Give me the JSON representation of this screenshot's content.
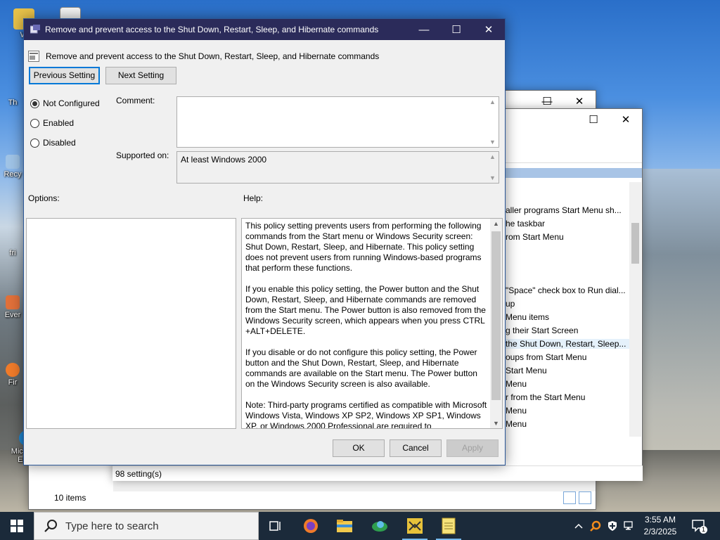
{
  "desktop": {
    "icons": [
      {
        "label": "W"
      },
      {
        "label": "Th"
      },
      {
        "label": "Recy"
      },
      {
        "label": "fri"
      },
      {
        "label": "Ever"
      },
      {
        "label": "Fir"
      },
      {
        "label": "Microsoft Edge"
      }
    ]
  },
  "background_window": {
    "status_items": "10 items",
    "status_settings": "98 setting(s)",
    "list_items": [
      "aller programs Start Menu sh...",
      "he taskbar",
      "rom Start Menu",
      "\"Space\" check box to Run dial...",
      "up",
      "Menu items",
      "g their Start Screen",
      "the Shut Down, Restart, Sleep...",
      "oups from Start Menu",
      "Start Menu",
      "Menu",
      "r from the Start Menu",
      "Menu",
      "Menu"
    ]
  },
  "dialog": {
    "window_title": "Remove and prevent access to the Shut Down, Restart, Sleep, and Hibernate commands",
    "policy_name": "Remove and prevent access to the Shut Down, Restart, Sleep, and Hibernate commands",
    "prev_label": "Previous Setting",
    "next_label": "Next Setting",
    "radio_not_configured": "Not Configured",
    "radio_enabled": "Enabled",
    "radio_disabled": "Disabled",
    "comment_label": "Comment:",
    "comment_value": "",
    "supported_label": "Supported on:",
    "supported_value": "At least Windows 2000",
    "options_label": "Options:",
    "help_label": "Help:",
    "help_paragraphs": [
      "This policy setting prevents users from performing the following commands from the Start menu or Windows Security screen: Shut Down, Restart, Sleep, and Hibernate. This policy setting does not prevent users from running Windows-based programs that perform these functions.",
      "If you enable this policy setting, the Power button and the Shut Down, Restart, Sleep, and Hibernate commands are removed from the Start menu. The Power button is also removed from the Windows Security screen, which appears when you press CTRL +ALT+DELETE.",
      "If you disable or do not configure this policy setting, the Power button and the Shut Down, Restart, Sleep, and Hibernate commands are available on the Start menu. The Power button on the Windows Security screen is also available.",
      "Note: Third-party programs certified as compatible with Microsoft Windows Vista, Windows XP SP2, Windows XP SP1, Windows XP, or Windows 2000 Professional are required to"
    ],
    "ok_label": "OK",
    "cancel_label": "Cancel",
    "apply_label": "Apply"
  },
  "taskbar": {
    "search_placeholder": "Type here to search",
    "time": "3:55 AM",
    "date": "2/3/2025",
    "notification_count": "1"
  },
  "colors": {
    "title_bar": "#2b2b5a",
    "dialog_bg": "#f0f0f0",
    "focus_blue": "#0078d7",
    "taskbar": "#1b2a3a"
  }
}
